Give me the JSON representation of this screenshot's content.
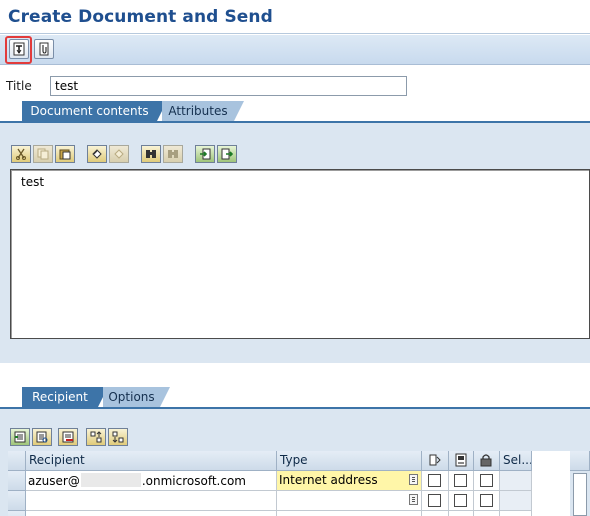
{
  "window": {
    "title": "Create Document and Send"
  },
  "toolbar": {
    "buttons": [
      {
        "icon": "send-icon"
      },
      {
        "icon": "attachment-icon"
      }
    ]
  },
  "title_field": {
    "label": "Title",
    "value": "test"
  },
  "doc_tabs": [
    {
      "label": "Document contents",
      "active": true
    },
    {
      "label": "Attributes",
      "active": false
    }
  ],
  "editor": {
    "text": "test",
    "toolbar_icons": [
      "cut-icon",
      "copy-icon",
      "paste-icon",
      "undo-icon",
      "redo-icon",
      "find-icon",
      "find-next-icon",
      "import-icon",
      "export-icon"
    ]
  },
  "recipient_tabs": [
    {
      "label": "Recipient",
      "active": true
    },
    {
      "label": "Options",
      "active": false
    }
  ],
  "recipient_toolbar_icons": [
    "insert-row-icon",
    "details-icon",
    "delete-row-icon",
    "sort-ascending-icon",
    "sort-descending-icon"
  ],
  "recipient_table": {
    "columns": [
      {
        "label": "Recipient"
      },
      {
        "label": "Type"
      },
      {
        "label": "",
        "icon": "express-icon"
      },
      {
        "label": "",
        "icon": "copy-recipient-icon"
      },
      {
        "label": "",
        "icon": "lock-icon"
      },
      {
        "label": "Sel..."
      }
    ],
    "rows": [
      {
        "recipient_prefix": "azuser@",
        "recipient_suffix": ".onmicrosoft.com",
        "type": "Internet address"
      },
      {
        "recipient_prefix": "",
        "recipient_suffix": "",
        "type": ""
      }
    ]
  },
  "colors": {
    "title": "#1f4f8f",
    "tab_active": "#3d74a8",
    "tab_inactive": "#a8c3de",
    "panel": "#dbe6f1",
    "highlight": "#e23b3b",
    "type_cell": "#fff6a8"
  }
}
